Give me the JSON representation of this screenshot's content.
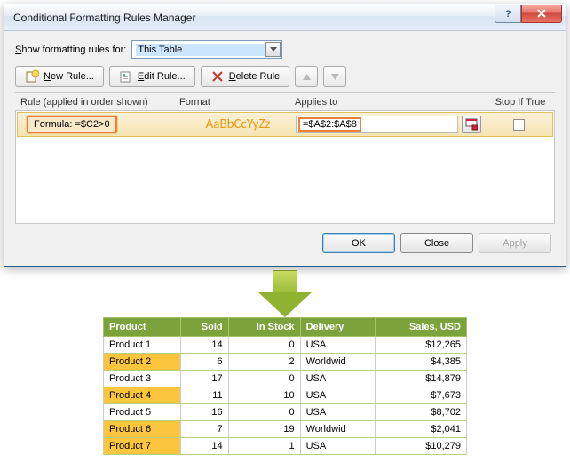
{
  "dialog": {
    "title": "Conditional Formatting Rules Manager",
    "show_label_pre": "S",
    "show_label_post": "how formatting rules for:",
    "select_value": "This Table",
    "buttons": {
      "new_pre": "N",
      "new_post": "ew Rule...",
      "edit_pre": "E",
      "edit_post": "dit Rule...",
      "delete_pre": "D",
      "delete_post": "elete Rule"
    },
    "columns": {
      "rule": "Rule (applied in order shown)",
      "format": "Format",
      "applies": "Applies to",
      "stop": "Stop If True"
    },
    "rule": {
      "description": "Formula: =$C2>0",
      "format_preview": "AaBbCcYyZz",
      "applies_to": "=$A$2:$A$8"
    },
    "ok": "OK",
    "close": "Close",
    "apply": "Apply"
  },
  "table": {
    "headers": [
      "Product",
      "Sold",
      "In Stock",
      "Delivery",
      "Sales,  USD"
    ],
    "rows": [
      {
        "p": "Product 1",
        "sold": "14",
        "stock": "0",
        "del": "USA",
        "sales": "$12,265",
        "hl": false
      },
      {
        "p": "Product 2",
        "sold": "6",
        "stock": "2",
        "del": "Worldwid",
        "sales": "$4,385",
        "hl": true
      },
      {
        "p": "Product 3",
        "sold": "17",
        "stock": "0",
        "del": "USA",
        "sales": "$14,879",
        "hl": false
      },
      {
        "p": "Product 4",
        "sold": "11",
        "stock": "10",
        "del": "USA",
        "sales": "$7,673",
        "hl": true
      },
      {
        "p": "Product 5",
        "sold": "16",
        "stock": "0",
        "del": "USA",
        "sales": "$8,702",
        "hl": false
      },
      {
        "p": "Product 6",
        "sold": "7",
        "stock": "19",
        "del": "Worldwid",
        "sales": "$2,041",
        "hl": true
      },
      {
        "p": "Product 7",
        "sold": "14",
        "stock": "1",
        "del": "USA",
        "sales": "$10,279",
        "hl": true
      }
    ]
  }
}
